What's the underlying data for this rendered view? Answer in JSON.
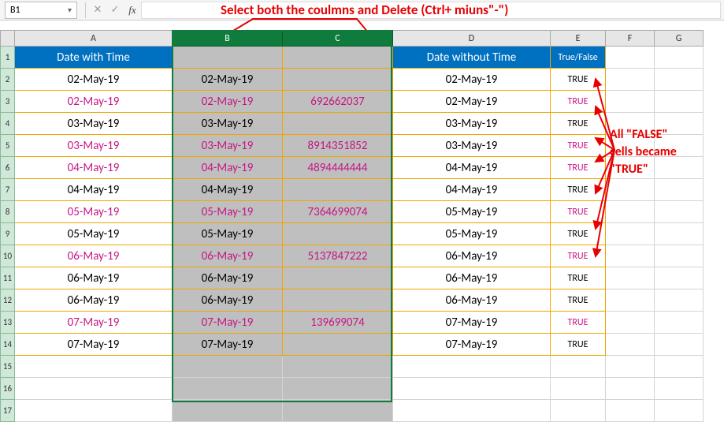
{
  "namebox": {
    "value": "B1"
  },
  "annotation": {
    "top": "Select both the coulmns and Delete (Ctrl+ miuns\"-\")",
    "right_l1": "All \"FALSE\"",
    "right_l2": "cells became",
    "right_l3": "\"TRUE\""
  },
  "columns": {
    "A": "A",
    "B": "B",
    "C": "C",
    "D": "D",
    "E": "E",
    "F": "F",
    "G": "G"
  },
  "rowlabels": [
    "1",
    "2",
    "3",
    "4",
    "5",
    "6",
    "7",
    "8",
    "9",
    "10",
    "11",
    "12",
    "13",
    "14",
    "15",
    "16",
    "17"
  ],
  "header": {
    "A": "Date with Time",
    "B": "",
    "C": "",
    "D": "Date without Time",
    "E": "True/False"
  },
  "rows": [
    {
      "A": "02-May-19",
      "B": "02-May-19",
      "C": "",
      "D": "02-May-19",
      "E": "TRUE",
      "pink": false
    },
    {
      "A": "02-May-19",
      "B": "02-May-19",
      "C": "692662037",
      "D": "02-May-19",
      "E": "TRUE",
      "pink": true
    },
    {
      "A": "03-May-19",
      "B": "03-May-19",
      "C": "",
      "D": "03-May-19",
      "E": "TRUE",
      "pink": false
    },
    {
      "A": "03-May-19",
      "B": "03-May-19",
      "C": "8914351852",
      "D": "03-May-19",
      "E": "TRUE",
      "pink": true
    },
    {
      "A": "04-May-19",
      "B": "04-May-19",
      "C": "4894444444",
      "D": "04-May-19",
      "E": "TRUE",
      "pink": true
    },
    {
      "A": "04-May-19",
      "B": "04-May-19",
      "C": "",
      "D": "04-May-19",
      "E": "TRUE",
      "pink": false
    },
    {
      "A": "05-May-19",
      "B": "05-May-19",
      "C": "7364699074",
      "D": "05-May-19",
      "E": "TRUE",
      "pink": true
    },
    {
      "A": "05-May-19",
      "B": "05-May-19",
      "C": "",
      "D": "05-May-19",
      "E": "TRUE",
      "pink": false
    },
    {
      "A": "06-May-19",
      "B": "06-May-19",
      "C": "5137847222",
      "D": "06-May-19",
      "E": "TRUE",
      "pink": true
    },
    {
      "A": "06-May-19",
      "B": "06-May-19",
      "C": "",
      "D": "06-May-19",
      "E": "TRUE",
      "pink": false
    },
    {
      "A": "06-May-19",
      "B": "06-May-19",
      "C": "",
      "D": "06-May-19",
      "E": "TRUE",
      "pink": false
    },
    {
      "A": "07-May-19",
      "B": "07-May-19",
      "C": "139699074",
      "D": "07-May-19",
      "E": "TRUE",
      "pink": true
    },
    {
      "A": "07-May-19",
      "B": "07-May-19",
      "C": "",
      "D": "07-May-19",
      "E": "TRUE",
      "pink": false
    }
  ]
}
